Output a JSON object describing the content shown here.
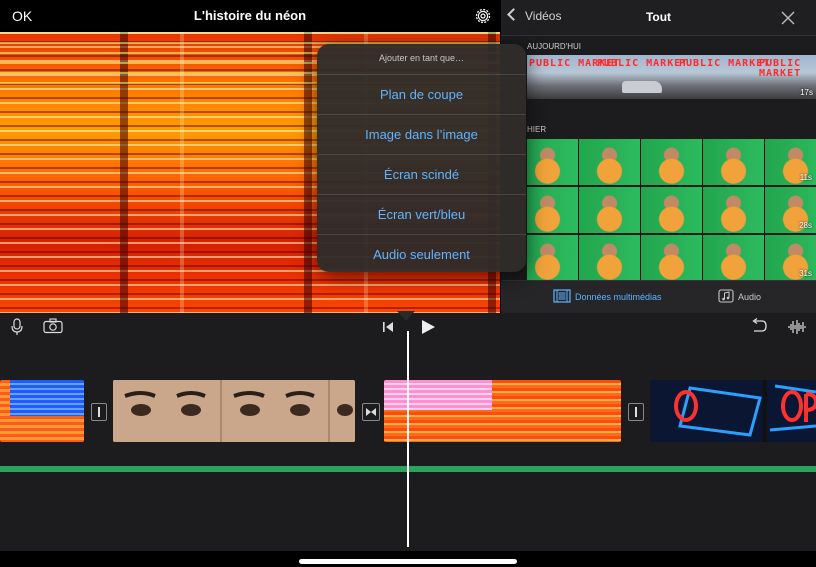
{
  "header": {
    "ok_label": "OK",
    "title": "L'histoire du néon"
  },
  "popover": {
    "header": "Ajouter en tant que…",
    "items": [
      "Plan de coupe",
      "Image dans l’image",
      "Écran scindé",
      "Écran vert/bleu",
      "Audio seulement"
    ]
  },
  "browser": {
    "back_label": "Vidéos",
    "title": "Tout",
    "today_label": "AUJOURD'HUI",
    "yesterday_label": "HIER",
    "today_clip": {
      "sign_text": [
        "PUBLIC MARKET",
        "PUBLIC MARKET",
        "PUBLIC MARKET",
        "PUBLIC MARKET"
      ],
      "duration": "17s"
    },
    "yesterday_durations": [
      "11s",
      "28s",
      "31s"
    ],
    "tabs": {
      "media": "Données multimédias",
      "audio": "Audio"
    }
  },
  "colors": {
    "accent": "#5fb4ff",
    "audio_track": "#2aa45a"
  },
  "icons": {
    "settings": "gear-icon",
    "close": "close-icon",
    "voiceover": "microphone-icon",
    "camera": "camera-icon",
    "skip_start": "skip-to-start-icon",
    "play": "play-icon",
    "undo": "undo-icon",
    "audio_wave": "waveform-icon",
    "media": "film-icon",
    "audio": "music-note-icon"
  }
}
